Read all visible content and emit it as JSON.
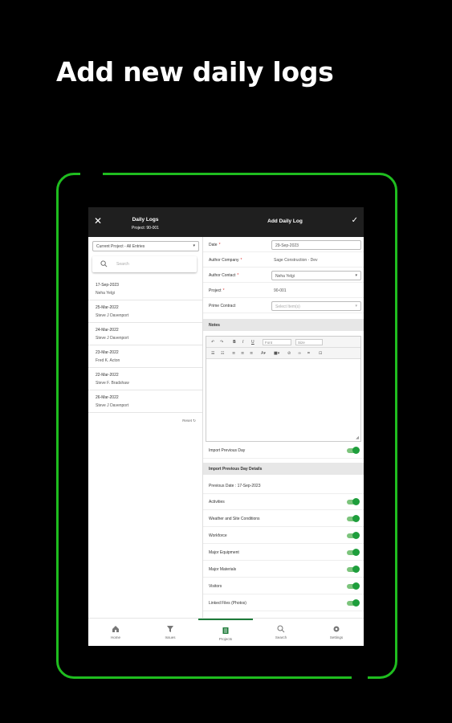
{
  "headline": "Add new daily logs",
  "topbar": {
    "close_icon": "close-icon",
    "list_title": "Daily Logs",
    "list_subtitle": "Project: 90-001",
    "form_title": "Add Daily Log",
    "save_icon": "checkmark-icon"
  },
  "left_panel": {
    "filter_value": "Current Project - All Entries",
    "search_placeholder": "Search",
    "entries": [
      {
        "date": "17-Sep-2023",
        "name": "Neha Yelgi"
      },
      {
        "date": "25-Mar-2022",
        "name": "Steve J Davenport"
      },
      {
        "date": "24-Mar-2022",
        "name": "Steve J Davenport"
      },
      {
        "date": "23-Mar-2022",
        "name": "Fred K. Acton"
      },
      {
        "date": "22-Mar-2022",
        "name": "Steve F. Bradshaw"
      },
      {
        "date": "26-Mar-2022",
        "name": "Steve J Davenport"
      }
    ],
    "reset_label": "Reset ↻"
  },
  "form": {
    "date_label": "Date",
    "date_value": "29-Sep-2023",
    "author_company_label": "Author Company",
    "author_company_value": "Sage Construction - Dev",
    "author_contact_label": "Author Contact",
    "author_contact_value": "Neha Yelgi",
    "project_label": "Project",
    "project_value": "90-001",
    "prime_contract_label": "Prime Contract",
    "prime_contract_placeholder": "Select Item(s)",
    "notes_section": "Notes",
    "toolbar": {
      "font_placeholder": "Font",
      "size_placeholder": "Size"
    },
    "import_previous_label": "Import Previous Day",
    "import_details_section": "Import Previous Day Details",
    "previous_date_label": "Previous Date : 17-Sep-2023",
    "toggles": [
      "Activities",
      "Weather and Site Conditions",
      "Workforce",
      "Major Equipment",
      "Major Materials",
      "Visitors",
      "Linked Files (Photos)"
    ]
  },
  "bottom_nav": [
    {
      "label": "Home",
      "icon": "home-icon"
    },
    {
      "label": "Issues",
      "icon": "filter-icon"
    },
    {
      "label": "Projects",
      "icon": "projects-icon",
      "active": true
    },
    {
      "label": "Search",
      "icon": "search-icon"
    },
    {
      "label": "Settings",
      "icon": "gear-icon"
    }
  ],
  "colors": {
    "accent_green": "#1fbd1f",
    "toggle_green": "#1e9e3c",
    "topbar": "#1f1f1f"
  }
}
